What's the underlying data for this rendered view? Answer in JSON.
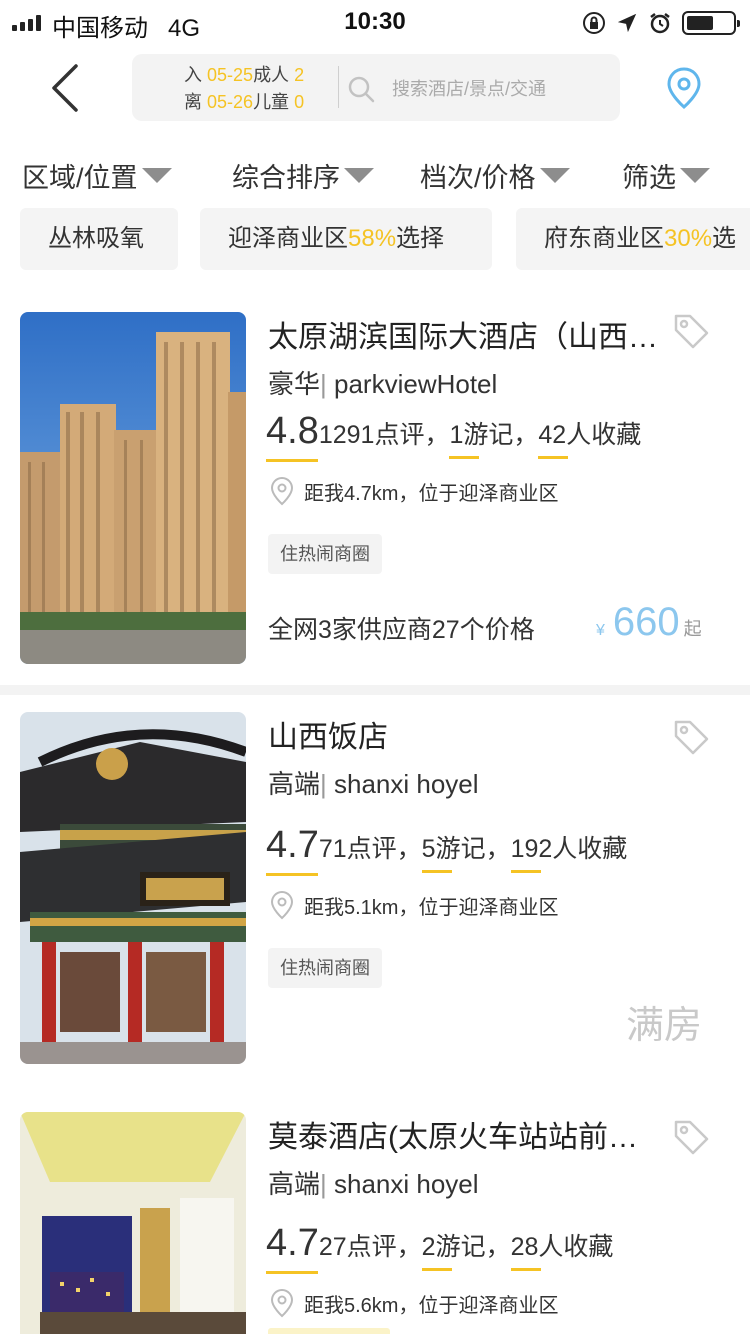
{
  "status_bar": {
    "carrier": "中国移动",
    "network": "4G",
    "time": "10:30"
  },
  "header": {
    "checkin_label": "入",
    "checkin_date": "05-25",
    "adults_label": "成人",
    "adults_count": "2",
    "checkout_label": "离",
    "checkout_date": "05-26",
    "children_label": "儿童",
    "children_count": "0",
    "search_placeholder": "搜索酒店/景点/交通"
  },
  "filters": [
    "区域/位置",
    "综合排序",
    "档次/价格",
    "筛选"
  ],
  "chips": [
    {
      "label": "丛林吸氧",
      "pct": "",
      "suffix": ""
    },
    {
      "label": "迎泽商业区",
      "pct": "58%",
      "suffix": "选择"
    },
    {
      "label": "府东商业区",
      "pct": "30%",
      "suffix": "选"
    }
  ],
  "hotels": [
    {
      "name": "太原湖滨国际大酒店（山西…",
      "grade": "豪华",
      "en_name": "parkviewHotel",
      "score": "4.8",
      "reviews_num": "1291",
      "reviews_label": "点评，",
      "notes_num": "1",
      "notes_label": "游记，",
      "fav_num": "42",
      "fav_label": "人收藏",
      "distance": "距我4.7km，位于迎泽商业区",
      "badge": "住热闹商圈",
      "supplier": "全网3家供应商27个价格",
      "currency": "¥",
      "price": "660",
      "price_suffix": "起"
    },
    {
      "name": "山西饭店",
      "grade": "高端",
      "en_name": "shanxi hoyel",
      "score": "4.7",
      "reviews_num": "71",
      "reviews_label": "点评，",
      "notes_num": "5",
      "notes_label": "游记，",
      "fav_num": "192",
      "fav_label": "人收藏",
      "distance": "距我5.1km，位于迎泽商业区",
      "badge": "住热闹商圈",
      "status": "满房"
    },
    {
      "name": "莫泰酒店(太原火车站站前…",
      "grade": "高端",
      "en_name": "shanxi hoyel",
      "score": "4.7",
      "reviews_num": "27",
      "reviews_label": "点评，",
      "notes_num": "2",
      "notes_label": "游记，",
      "fav_num": "28",
      "fav_label": "人收藏",
      "distance": "距我5.6km，位于迎泽商业区"
    }
  ],
  "colors": {
    "accent_yellow": "#f5c324",
    "price_blue": "#8cc7ee",
    "location_blue": "#5fb6ec"
  }
}
